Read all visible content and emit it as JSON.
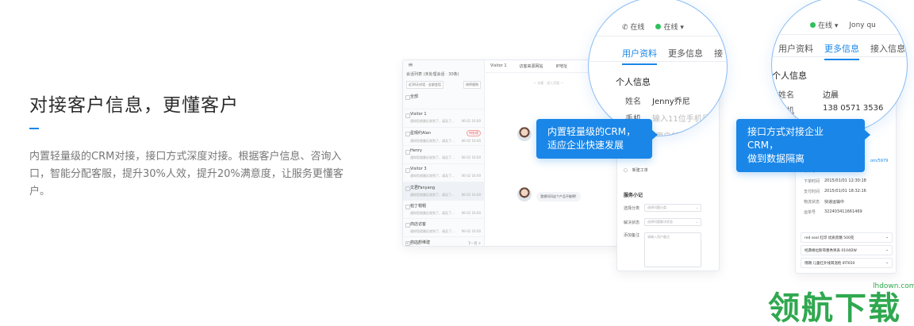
{
  "hero": {
    "title": "对接客户信息，更懂客户",
    "description": "内置轻量级的CRM对接，接口方式深度对接。根据客户信息、咨询入口，智能分配客服，提升30%人效，提升20%满意度，让服务更懂客户。"
  },
  "colors": {
    "accent": "#1a86e8",
    "watermark": "#2fa84f"
  },
  "app": {
    "menu_icon": "≡",
    "sessions_header": "会话列表 (未处理会话 · 30条)",
    "filter_time": "近30天对话 · 全部会话",
    "filter_sort": "排序规则",
    "sessions": [
      {
        "name": "全部",
        "msg": "",
        "time": "",
        "tag": ""
      },
      {
        "name": "Visitor 1",
        "msg": "通知您就最近收到了，请及了...",
        "time": "06-02 16:00",
        "tag": ""
      },
      {
        "name": "星晴约Alan",
        "msg": "通知您就最近收到了，请及了...",
        "time": "06-02 16:00",
        "tag": "待处理"
      },
      {
        "name": "Henry",
        "msg": "通知您就最近收到了，请及了...",
        "time": "06-02 16:00",
        "tag": ""
      },
      {
        "name": "Visitor 3",
        "msg": "通知您就最近收到了，请及了...",
        "time": "06-02 16:00",
        "tag": ""
      },
      {
        "name": "文君Fanyang",
        "msg": "通知您就最近收到了，请及了...",
        "time": "06-02 16:00",
        "tag": ""
      },
      {
        "name": "帕丁帽帽",
        "msg": "通知您就最近收到了，请及了...",
        "time": "06-02 16:00",
        "tag": ""
      },
      {
        "name": "商店访客",
        "msg": "通知您就最近收到了，请及了...",
        "time": "06-02 16:00",
        "tag": ""
      },
      {
        "name": "商店想维建",
        "msg": "通知您就最近收到了，请及了...",
        "time": "06-02 16:00",
        "tag": ""
      }
    ],
    "prev_page": "< 上一页",
    "next_page": "下一页 >",
    "chat_title": "Visitor 1",
    "chat_meta1": "访客来源网站",
    "chat_meta2": "IP地址",
    "chat_note": "— 访客 · 进入页面 —",
    "bubble1": "好的，请问你...",
    "bubble2": "我想询问下产品...",
    "bubble3": "我想问问这个产品不能啊!",
    "new_ticket": "新建工单",
    "tag_label": "添加"
  },
  "crm": {
    "service_notes": "服务小记",
    "category_label": "选择分类",
    "category_ph": "选择问题分类",
    "status_label": "解决状态",
    "status_ph": "选择问题解决状态",
    "remark_label": "添加备注",
    "remark_ph": "请输入用户备注"
  },
  "orders": {
    "rows": [
      {
        "k": "订单号",
        "v": "97020010"
      },
      {
        "k": "下单时间",
        "v": "2015/01/01  12:30:18"
      },
      {
        "k": "支付时间",
        "v": "2015/01/01  18:32:16"
      },
      {
        "k": "物流状态",
        "v": "快递运输中"
      },
      {
        "k": "运单号",
        "v": "322403411661469"
      }
    ],
    "link_fragment": "om/5979",
    "products": [
      "red seal 红印 优质黑糖 500克",
      "经典格拉斯哥墨秀男表 0104DW",
      "博朗 儿童红外线耳温枪 IRT650"
    ]
  },
  "zoom1": {
    "status_phone": "在线",
    "status_chat": "在线",
    "tab_profile": "用户资料",
    "tab_more": "更多信息",
    "tab_access": "接",
    "section": "个人信息",
    "name_label": "姓名",
    "name_value": "Jenny乔尼",
    "phone_label": "手机",
    "phone_ph": "输入11位手机号",
    "email_ph": "用户邮箱"
  },
  "zoom2": {
    "status_chat": "在线",
    "agent": "Jony qu",
    "tab_profile": "用户资料",
    "tab_more": "更多信息",
    "tab_access": "接入信息",
    "section": "个人信息",
    "name_label": "姓名",
    "name_value": "边晨",
    "phone_label": "手机",
    "phone_value": "138 0571 3536"
  },
  "callouts": {
    "left": "内置轻量级的CRM，\n适应企业快速发展",
    "right": "接口方式对接企业CRM，\n做到数据隔离"
  },
  "watermark": {
    "text": "领航下载",
    "url": "lhdown.com"
  }
}
